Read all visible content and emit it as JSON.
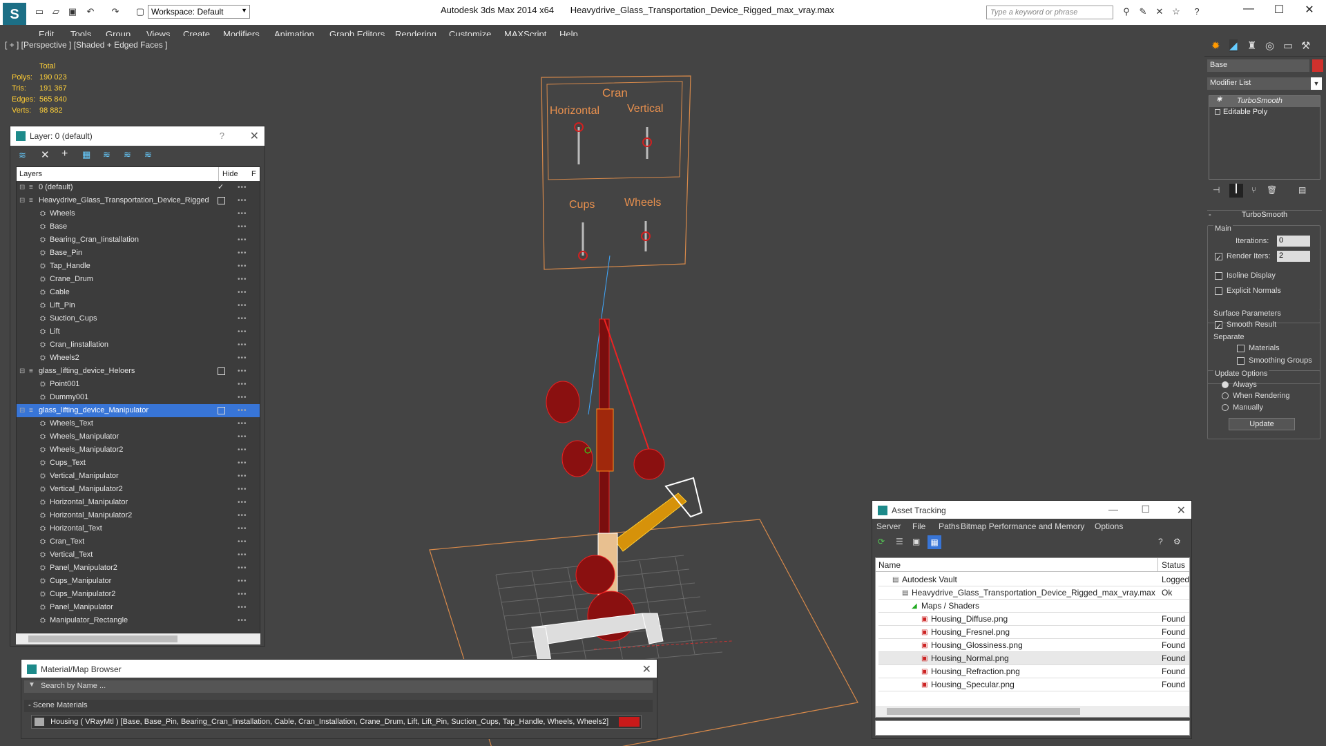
{
  "app": {
    "name": "Autodesk 3ds Max  2014 x64",
    "file": "Heavydrive_Glass_Transportation_Device_Rigged_max_vray.max",
    "workspace": "Workspace: Default",
    "search_placeholder": "Type a keyword or phrase"
  },
  "menu": [
    "Edit",
    "Tools",
    "Group",
    "Views",
    "Create",
    "Modifiers",
    "Animation",
    "Graph Editors",
    "Rendering",
    "Customize",
    "MAXScript",
    "Help"
  ],
  "viewport": {
    "label": "[ + ] [Perspective ] [Shaded + Edged Faces ]",
    "stats_header": "Total",
    "stats": [
      {
        "k": "Polys:",
        "v": "190 023"
      },
      {
        "k": "Tris:",
        "v": "191 367"
      },
      {
        "k": "Edges:",
        "v": "565 840"
      },
      {
        "k": "Verts:",
        "v": "98 882"
      }
    ],
    "panel_labels": {
      "cran": "Cran",
      "horizontal": "Horizontal",
      "vertical": "Vertical",
      "cups": "Cups",
      "wheels": "Wheels"
    }
  },
  "layer_panel": {
    "title": "Layer: 0 (default)",
    "help": "?",
    "col_layers": "Layers",
    "col_hide": "Hide",
    "col_f": "F",
    "rows": [
      {
        "name": "0 (default)",
        "level": 0,
        "check": true
      },
      {
        "name": "Heavydrive_Glass_Transportation_Device_Rigged",
        "level": 0,
        "box": true
      },
      {
        "name": "Wheels",
        "level": 1
      },
      {
        "name": "Base",
        "level": 1
      },
      {
        "name": "Bearing_Cran_Iinstallation",
        "level": 1
      },
      {
        "name": "Base_Pin",
        "level": 1
      },
      {
        "name": "Tap_Handle",
        "level": 1
      },
      {
        "name": "Crane_Drum",
        "level": 1
      },
      {
        "name": "Cable",
        "level": 1
      },
      {
        "name": "Lift_Pin",
        "level": 1
      },
      {
        "name": "Suction_Cups",
        "level": 1
      },
      {
        "name": "Lift",
        "level": 1
      },
      {
        "name": "Cran_Iinstallation",
        "level": 1
      },
      {
        "name": "Wheels2",
        "level": 1
      },
      {
        "name": "glass_lifting_device_Heloers",
        "level": 0,
        "box": true
      },
      {
        "name": "Point001",
        "level": 1
      },
      {
        "name": "Dummy001",
        "level": 1
      },
      {
        "name": "glass_lifting_device_Manipulator",
        "level": 0,
        "box": true,
        "selected": true
      },
      {
        "name": "Wheels_Text",
        "level": 1
      },
      {
        "name": "Wheels_Manipulator",
        "level": 1
      },
      {
        "name": "Wheels_Manipulator2",
        "level": 1
      },
      {
        "name": "Cups_Text",
        "level": 1
      },
      {
        "name": "Vertical_Manipulator",
        "level": 1
      },
      {
        "name": "Vertical_Manipulator2",
        "level": 1
      },
      {
        "name": "Horizontal_Manipulator",
        "level": 1
      },
      {
        "name": "Horizontal_Manipulator2",
        "level": 1
      },
      {
        "name": "Horizontal_Text",
        "level": 1
      },
      {
        "name": "Cran_Text",
        "level": 1
      },
      {
        "name": "Vertical_Text",
        "level": 1
      },
      {
        "name": "Panel_Manipulator2",
        "level": 1
      },
      {
        "name": "Cups_Manipulator",
        "level": 1
      },
      {
        "name": "Cups_Manipulator2",
        "level": 1
      },
      {
        "name": "Panel_Manipulator",
        "level": 1
      },
      {
        "name": "Manipulator_Rectangle",
        "level": 1
      }
    ]
  },
  "material_browser": {
    "title": "Material/Map Browser",
    "search_placeholder": "Search by Name ...",
    "section": "- Scene Materials",
    "item": "Housing  ( VRayMtl ) [Base, Base_Pin, Bearing_Cran_Iinstallation, Cable, Cran_Installation, Crane_Drum, Lift, Lift_Pin, Suction_Cups, Tap_Handle, Wheels, Wheels2]"
  },
  "asset_tracking": {
    "title": "Asset Tracking",
    "menu": [
      "Server",
      "File",
      "Paths",
      "Bitmap Performance and Memory",
      "Options"
    ],
    "col_name": "Name",
    "col_status": "Status",
    "rows": [
      {
        "name": "Autodesk Vault",
        "status": "Logged",
        "level": 1
      },
      {
        "name": "Heavydrive_Glass_Transportation_Device_Rigged_max_vray.max",
        "status": "Ok",
        "level": 2
      },
      {
        "name": "Maps / Shaders",
        "status": "",
        "level": 3
      },
      {
        "name": "Housing_Diffuse.png",
        "status": "Found",
        "level": 4
      },
      {
        "name": "Housing_Fresnel.png",
        "status": "Found",
        "level": 4
      },
      {
        "name": "Housing_Glossiness.png",
        "status": "Found",
        "level": 4
      },
      {
        "name": "Housing_Normal.png",
        "status": "Found",
        "level": 4
      },
      {
        "name": "Housing_Refraction.png",
        "status": "Found",
        "level": 4
      },
      {
        "name": "Housing_Specular.png",
        "status": "Found",
        "level": 4
      }
    ]
  },
  "command_panel": {
    "object_name": "Base",
    "modifier_list": "Modifier List",
    "stack": [
      "TurboSmooth",
      "Editable Poly"
    ],
    "rollout": "TurboSmooth",
    "main": "Main",
    "iterations_label": "Iterations:",
    "iterations_value": "0",
    "render_iters_label": "Render Iters:",
    "render_iters_value": "2",
    "isoline": "Isoline Display",
    "explicit": "Explicit Normals",
    "surface_params": "Surface Parameters",
    "smooth_result": "Smooth Result",
    "separate": "Separate",
    "materials": "Materials",
    "smoothing_groups": "Smoothing Groups",
    "update_options": "Update Options",
    "always": "Always",
    "when_rendering": "When Rendering",
    "manually": "Manually",
    "update_button": "Update",
    "accent": "#d0312d"
  }
}
